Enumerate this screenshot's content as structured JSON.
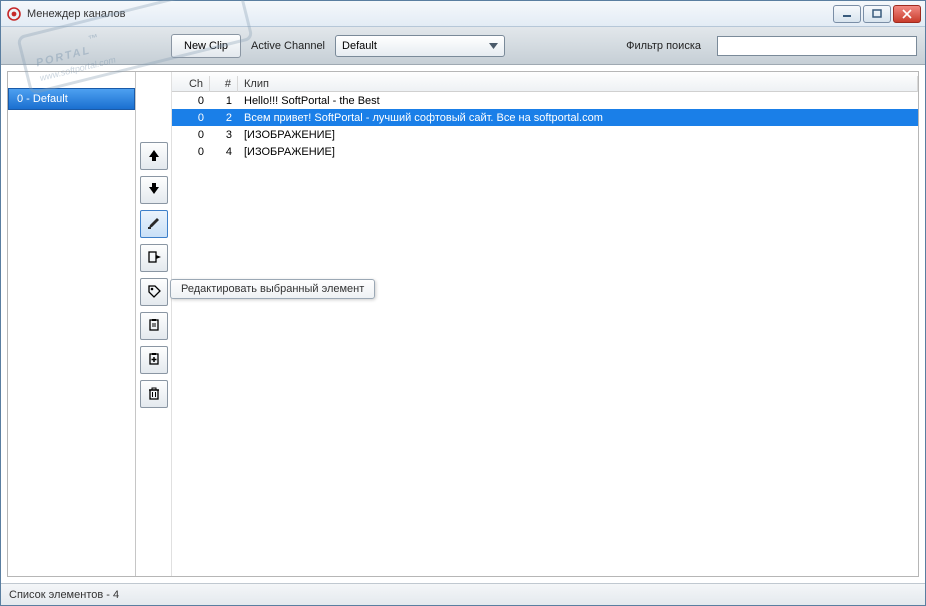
{
  "window": {
    "title": "Менеждер каналов"
  },
  "toolbar": {
    "new_clip": "New Clip",
    "active_channel_label": "Active Channel",
    "active_channel_value": "Default",
    "filter_label": "Фильтр поиска",
    "filter_value": ""
  },
  "sidebar": {
    "channels": [
      {
        "id": 0,
        "label": "0 - Default"
      }
    ]
  },
  "columns": {
    "ch": "Ch",
    "num": "#",
    "clip": "Клип"
  },
  "rows": [
    {
      "ch": "0",
      "n": "1",
      "clip": "Hello!!! SoftPortal - the Best",
      "selected": false
    },
    {
      "ch": "0",
      "n": "2",
      "clip": "Всем привет! SoftPortal - лучший софтовый сайт. Все на softportal.com",
      "selected": true
    },
    {
      "ch": "0",
      "n": "3",
      "clip": "[ИЗОБРАЖЕНИЕ]",
      "selected": false
    },
    {
      "ch": "0",
      "n": "4",
      "clip": "[ИЗОБРАЖЕНИЕ]",
      "selected": false
    }
  ],
  "tooltip": "Редактировать выбранный элемент",
  "statusbar": {
    "text": "Список элементов - 4"
  },
  "icons": {
    "up": "arrow-up-icon",
    "down": "arrow-down-icon",
    "edit": "pencil-icon",
    "export": "export-icon",
    "tag": "tag-icon",
    "paste": "clipboard-paste-icon",
    "add": "clipboard-add-icon",
    "delete": "trash-icon"
  },
  "watermark": {
    "big": "PORTAL",
    "small": "www.softportal.com",
    "tm": "™"
  }
}
